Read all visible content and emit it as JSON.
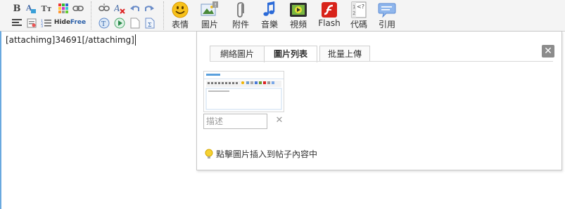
{
  "toolbar": {
    "small_icons_row1": [
      "bold-icon",
      "text-color-icon",
      "font-size-icon",
      "background-color-icon",
      "link-icon",
      "unlink-icon",
      "remove-format-icon",
      "undo-icon",
      "redo-icon"
    ],
    "small_icons_row2": [
      "align-icon",
      "numbered-list-icon",
      "bullet-list-icon",
      "hide-icon",
      "free-icon",
      "paste-text-icon",
      "paste-word-icon",
      "blank-page-icon",
      "formula-icon"
    ],
    "hide_label": "Hide",
    "free_label": "Free",
    "buttons": [
      {
        "icon": "smiley-icon",
        "label": "表情"
      },
      {
        "icon": "picture-icon",
        "label": "圖片"
      },
      {
        "icon": "paperclip-icon",
        "label": "附件"
      },
      {
        "icon": "music-note-icon",
        "label": "音樂"
      },
      {
        "icon": "video-icon",
        "label": "視頻"
      },
      {
        "icon": "flash-icon",
        "label": "Flash"
      },
      {
        "icon": "code-icon",
        "label": "代碼"
      },
      {
        "icon": "quote-bubble-icon",
        "label": "引用"
      }
    ]
  },
  "editor": {
    "content": "[attachimg]34691[/attachimg]"
  },
  "popup": {
    "tabs": [
      {
        "label": "網絡圖片",
        "active": false
      },
      {
        "label": "圖片列表",
        "active": true
      },
      {
        "label": "批量上傳",
        "active": false
      }
    ],
    "close_symbol": "✕",
    "description_placeholder": "描述",
    "delete_symbol": "✕",
    "hint": "點擊圖片插入到帖子內容中"
  },
  "colors": {
    "editor_border": "#6aa9df",
    "toolbar_bg": "#f4f4f4",
    "close_bg": "#8c8c8c"
  }
}
